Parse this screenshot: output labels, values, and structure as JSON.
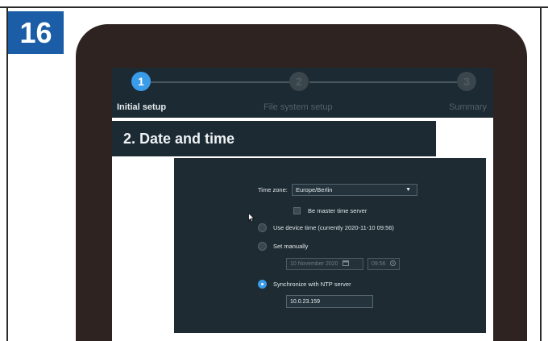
{
  "badge": {
    "number": "16"
  },
  "wizard": {
    "steps": [
      {
        "number": "1",
        "label": "Initial setup",
        "active": true
      },
      {
        "number": "2",
        "label": "File system setup",
        "active": false
      },
      {
        "number": "3",
        "label": "Summary",
        "active": false
      }
    ]
  },
  "section": {
    "title": "2.  Date and time"
  },
  "settings": {
    "timezone": {
      "label": "Time zone:",
      "value": "Europe/Berlin"
    },
    "master_time_server": {
      "label": "Be master time server",
      "checked": false
    },
    "use_device_time": {
      "label": "Use device time (currently 2020-11-10 09:56)",
      "selected": false
    },
    "set_manually": {
      "label": "Set manually",
      "selected": false,
      "date_value": "10 November 2020",
      "time_value": "09:56"
    },
    "ntp": {
      "label": "Synchronize with NTP server",
      "selected": true,
      "server_value": "10.0.23.159"
    }
  },
  "colors": {
    "badge": "#1b5ea7",
    "device_bezel": "#2e2321",
    "wizard_bg": "#1b2a33",
    "panel_bg": "#1e2b33",
    "accent": "#3a9be8"
  }
}
